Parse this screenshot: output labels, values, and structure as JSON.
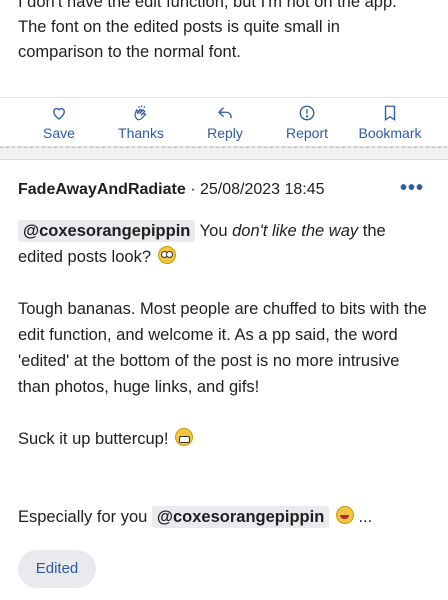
{
  "prev_post": {
    "line1": "I don't have the edit function, but I'm not on the app.",
    "line2": "The font on the edited posts is quite small in",
    "line3": "comparison to the normal font."
  },
  "actions": {
    "save": "Save",
    "thanks": "Thanks",
    "reply": "Reply",
    "report": "Report",
    "bookmark": "Bookmark"
  },
  "post": {
    "author": "FadeAwayAndRadiate",
    "separator": " · ",
    "datetime": "25/08/2023 18:45",
    "more": "•••",
    "mention": "@coxesorangepippin",
    "p1_a": " You ",
    "p1_em": "don't like the way",
    "p1_b": " the",
    "p1_c": "edited posts look? ",
    "p2": "Tough bananas. Most people are chuffed to bits with the edit function, and welcome it. As a pp said, the word 'edited' at the bottom of the post is no more intrusive than photos, huge links, and gifs!",
    "p3": "Suck it up buttercup! ",
    "p4_a": "Especially for you ",
    "p4_b": " ...",
    "edited_label": "Edited"
  },
  "colors": {
    "accent": "#2b5aa6",
    "mention_bg": "#e9e9ee"
  },
  "icons": [
    "heart-icon",
    "clapping-hands-icon",
    "reply-arrow-icon",
    "report-icon",
    "bookmark-icon",
    "more-options-icon",
    "rolling-eyes-emoji",
    "grimacing-emoji",
    "laughing-emoji"
  ]
}
